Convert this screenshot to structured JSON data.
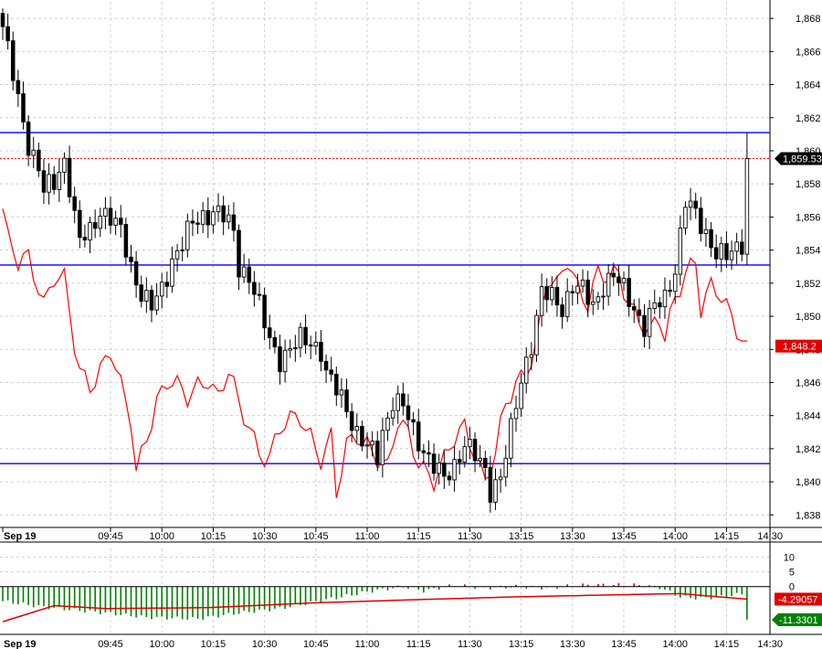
{
  "colors": {
    "background": "#ffffff",
    "grid": "#cfcfcf",
    "candle": "#000000",
    "overlay_line": "#ff0000",
    "hline": "#0000ff",
    "price_tag": "#000000",
    "overlay_tag": "#e00000",
    "hist_positive": "#e00000",
    "hist_negative": "#008000",
    "signal_line": "#e00000",
    "signal_tag": "#008000"
  },
  "chart_data": [
    {
      "type": "candlestick",
      "title": "",
      "x_tick_labels": [
        "Sep 19",
        "09:45",
        "10:00",
        "10:15",
        "10:30",
        "10:45",
        "11:00",
        "11:15",
        "11:30",
        "13:15",
        "13:30",
        "13:45",
        "14:00",
        "14:15",
        "14:30"
      ],
      "y_tick_labels": [
        "1,838",
        "1,840",
        "1,842",
        "1,844",
        "1,846",
        "1,848",
        "1,850",
        "1,852",
        "1,854",
        "1,856",
        "1,858",
        "1,860",
        "1,862",
        "1,864",
        "1,866",
        "1,868"
      ],
      "ylim": [
        1837.3,
        1869.0
      ],
      "grid": true,
      "horizontal_lines": [
        1861.1,
        1853.1,
        1841.1
      ],
      "last_price": 1859.53,
      "last_price_label": "1,859.53",
      "overlay_last_label": "1,848.2",
      "close_path": [
        [
          0,
          1867.5
        ],
        [
          1,
          1866.0
        ],
        [
          3,
          1863.0
        ],
        [
          5,
          1860.5
        ],
        [
          7,
          1859.0
        ],
        [
          8,
          1857.5
        ],
        [
          10,
          1858.0
        ],
        [
          12,
          1859.5
        ],
        [
          13,
          1858.0
        ],
        [
          14,
          1856.0
        ],
        [
          15,
          1854.5
        ],
        [
          17,
          1855.0
        ],
        [
          19,
          1856.5
        ],
        [
          21,
          1856.0
        ],
        [
          23,
          1855.0
        ],
        [
          25,
          1853.0
        ],
        [
          27,
          1851.5
        ],
        [
          29,
          1850.5
        ],
        [
          31,
          1851.5
        ],
        [
          33,
          1853.5
        ],
        [
          35,
          1854.5
        ],
        [
          37,
          1855.5
        ],
        [
          39,
          1856.0
        ],
        [
          41,
          1856.5
        ],
        [
          43,
          1856.0
        ],
        [
          45,
          1855.0
        ],
        [
          46,
          1853.0
        ],
        [
          48,
          1852.5
        ],
        [
          50,
          1850.5
        ],
        [
          52,
          1848.5
        ],
        [
          54,
          1847.5
        ],
        [
          56,
          1848.0
        ],
        [
          58,
          1848.5
        ],
        [
          60,
          1848.5
        ],
        [
          62,
          1848.0
        ],
        [
          63,
          1846.5
        ],
        [
          65,
          1845.5
        ],
        [
          67,
          1844.5
        ],
        [
          69,
          1843.0
        ],
        [
          71,
          1842.0
        ],
        [
          73,
          1841.5
        ],
        [
          74,
          1843.0
        ],
        [
          76,
          1845.0
        ],
        [
          78,
          1844.5
        ],
        [
          80,
          1843.0
        ],
        [
          82,
          1842.0
        ],
        [
          84,
          1841.0
        ],
        [
          86,
          1840.0
        ],
        [
          88,
          1841.0
        ],
        [
          90,
          1842.5
        ],
        [
          92,
          1841.5
        ],
        [
          94,
          1840.5
        ],
        [
          95,
          1839.5
        ],
        [
          97,
          1840.5
        ],
        [
          99,
          1843.0
        ],
        [
          101,
          1846.0
        ],
        [
          103,
          1848.5
        ],
        [
          105,
          1851.5
        ],
        [
          107,
          1851.0
        ],
        [
          109,
          1850.5
        ],
        [
          111,
          1852.0
        ],
        [
          113,
          1851.5
        ],
        [
          115,
          1850.5
        ],
        [
          117,
          1852.0
        ],
        [
          119,
          1852.5
        ],
        [
          121,
          1851.5
        ],
        [
          123,
          1850.5
        ],
        [
          125,
          1849.5
        ],
        [
          127,
          1850.5
        ],
        [
          129,
          1851.0
        ],
        [
          131,
          1853.0
        ],
        [
          133,
          1857.0
        ],
        [
          135,
          1856.0
        ],
        [
          137,
          1855.0
        ],
        [
          139,
          1854.0
        ],
        [
          141,
          1853.5
        ],
        [
          143,
          1854.0
        ],
        [
          144,
          1854.5
        ],
        [
          145,
          1859.5
        ]
      ],
      "overlay_line": [
        [
          0,
          1856.5
        ],
        [
          1,
          1854.5
        ],
        [
          3,
          1853.0
        ],
        [
          5,
          1853.5
        ],
        [
          7,
          1852.0
        ],
        [
          8,
          1851.0
        ],
        [
          10,
          1852.5
        ],
        [
          12,
          1852.0
        ],
        [
          14,
          1848.0
        ],
        [
          15,
          1846.5
        ],
        [
          17,
          1846.0
        ],
        [
          19,
          1847.0
        ],
        [
          21,
          1848.0
        ],
        [
          23,
          1845.5
        ],
        [
          25,
          1843.5
        ],
        [
          26,
          1840.5
        ],
        [
          28,
          1843.0
        ],
        [
          30,
          1845.0
        ],
        [
          32,
          1846.0
        ],
        [
          34,
          1845.5
        ],
        [
          36,
          1845.0
        ],
        [
          38,
          1846.0
        ],
        [
          40,
          1846.5
        ],
        [
          42,
          1845.0
        ],
        [
          44,
          1846.5
        ],
        [
          46,
          1844.5
        ],
        [
          48,
          1843.5
        ],
        [
          50,
          1842.0
        ],
        [
          52,
          1841.5
        ],
        [
          54,
          1843.0
        ],
        [
          56,
          1843.5
        ],
        [
          58,
          1844.0
        ],
        [
          60,
          1843.0
        ],
        [
          62,
          1841.5
        ],
        [
          64,
          1842.5
        ],
        [
          65,
          1839.0
        ],
        [
          67,
          1842.0
        ],
        [
          69,
          1843.0
        ],
        [
          71,
          1842.5
        ],
        [
          73,
          1841.5
        ],
        [
          75,
          1840.5
        ],
        [
          77,
          1843.5
        ],
        [
          79,
          1843.0
        ],
        [
          81,
          1841.5
        ],
        [
          83,
          1840.5
        ],
        [
          84,
          1840.0
        ],
        [
          86,
          1841.0
        ],
        [
          88,
          1842.5
        ],
        [
          90,
          1843.5
        ],
        [
          92,
          1842.0
        ],
        [
          94,
          1840.0
        ],
        [
          96,
          1841.5
        ],
        [
          98,
          1844.5
        ],
        [
          100,
          1846.0
        ],
        [
          102,
          1847.0
        ],
        [
          104,
          1848.5
        ],
        [
          106,
          1852.0
        ],
        [
          108,
          1851.5
        ],
        [
          110,
          1853.5
        ],
        [
          112,
          1852.0
        ],
        [
          114,
          1851.0
        ],
        [
          116,
          1852.5
        ],
        [
          118,
          1852.0
        ],
        [
          120,
          1852.5
        ],
        [
          122,
          1851.0
        ],
        [
          124,
          1850.0
        ],
        [
          126,
          1849.0
        ],
        [
          128,
          1849.5
        ],
        [
          129,
          1848.5
        ],
        [
          131,
          1851.0
        ],
        [
          133,
          1853.0
        ],
        [
          135,
          1853.5
        ],
        [
          136,
          1850.5
        ],
        [
          138,
          1851.5
        ],
        [
          140,
          1851.0
        ],
        [
          142,
          1850.0
        ],
        [
          144,
          1849.0
        ],
        [
          145,
          1848.2
        ]
      ],
      "bar_count": 146
    },
    {
      "type": "histogram",
      "y_tick_labels": [
        "10",
        "5",
        "0"
      ],
      "ylim": [
        -16,
        13
      ],
      "histogram_label": "-4.29057",
      "signal_label": "-11.3301",
      "histogram_path": [
        [
          0,
          -5
        ],
        [
          8,
          -7
        ],
        [
          20,
          -9
        ],
        [
          28,
          -10.5
        ],
        [
          38,
          -11
        ],
        [
          46,
          -9
        ],
        [
          54,
          -7.5
        ],
        [
          60,
          -5.5
        ],
        [
          66,
          -3.5
        ],
        [
          72,
          -1.5
        ],
        [
          78,
          0
        ],
        [
          82,
          -1.5
        ],
        [
          88,
          0.5
        ],
        [
          94,
          -0.5
        ],
        [
          100,
          0
        ],
        [
          106,
          -0.5
        ],
        [
          112,
          0.5
        ],
        [
          118,
          0.6
        ],
        [
          124,
          0.5
        ],
        [
          128,
          -0.3
        ],
        [
          132,
          -3.5
        ],
        [
          136,
          -4
        ],
        [
          140,
          -3.5
        ],
        [
          144,
          -2.5
        ],
        [
          145,
          -11.3
        ]
      ],
      "signal_path": [
        [
          0,
          -12
        ],
        [
          10,
          -6.5
        ],
        [
          20,
          -7.5
        ],
        [
          40,
          -7.2
        ],
        [
          60,
          -5.6
        ],
        [
          80,
          -4.5
        ],
        [
          100,
          -3.5
        ],
        [
          120,
          -2.8
        ],
        [
          132,
          -2.4
        ],
        [
          145,
          -4.29
        ]
      ]
    }
  ]
}
